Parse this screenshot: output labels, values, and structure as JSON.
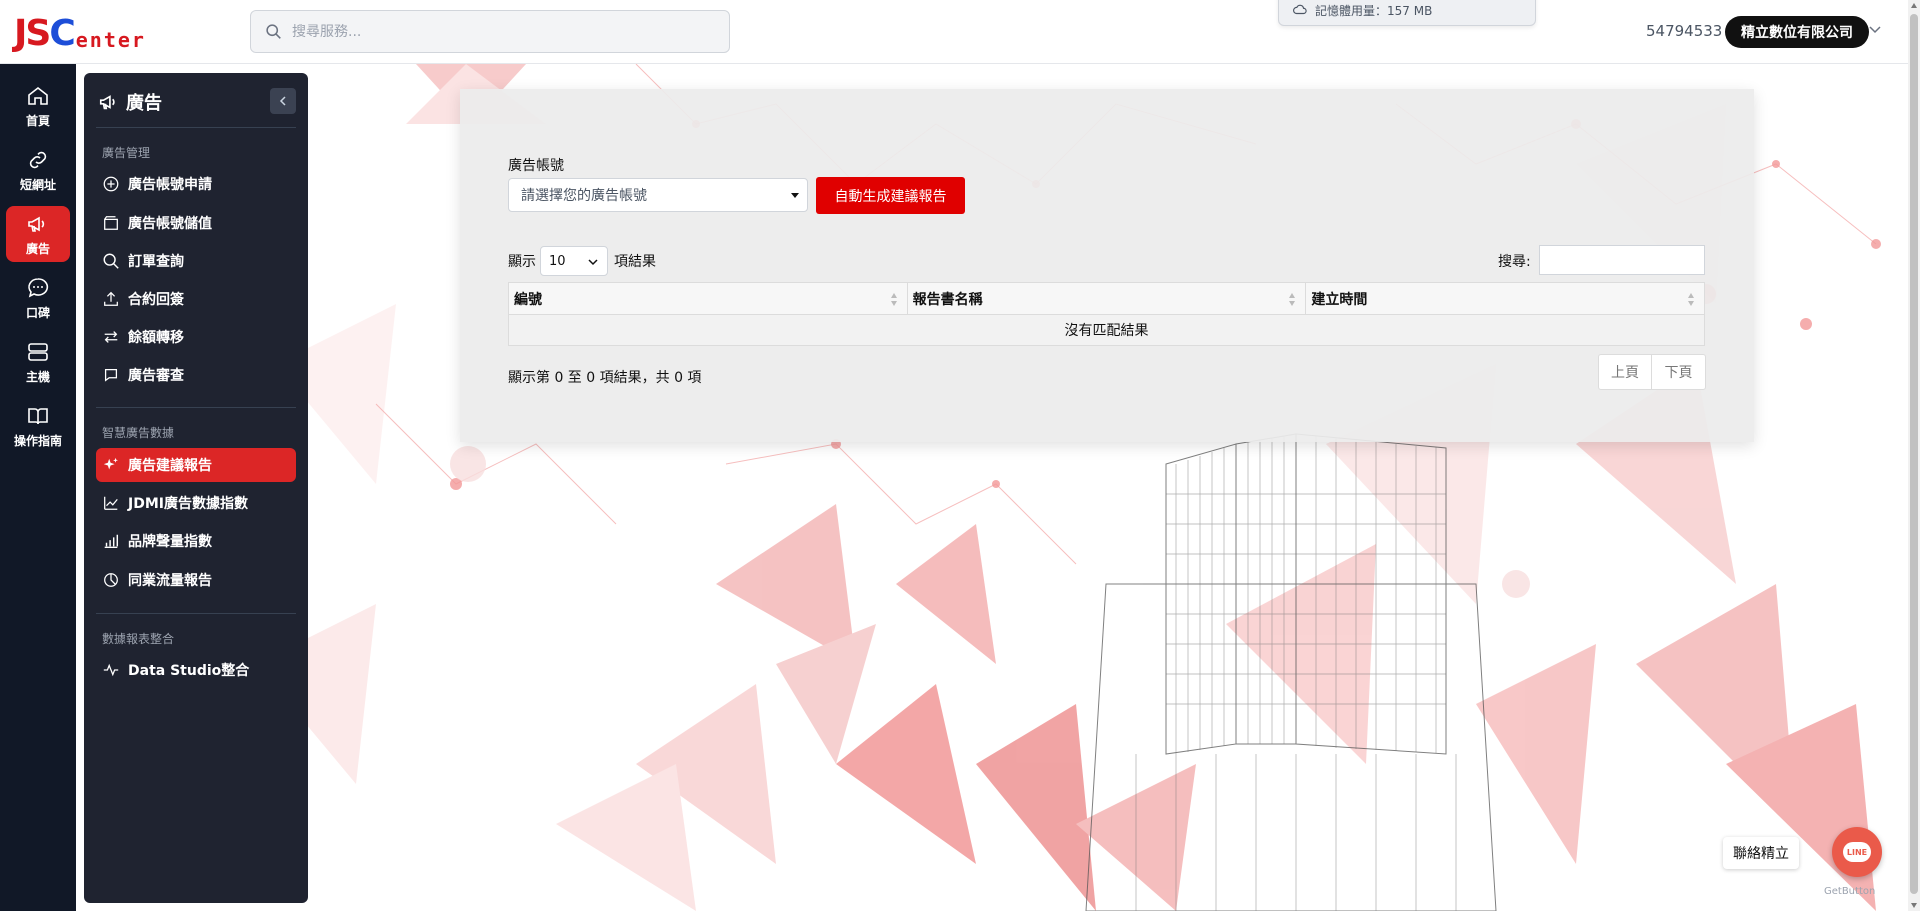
{
  "header": {
    "logo_text_main": "JSC",
    "logo_text_sub": "enter",
    "search_placeholder": "搜尋服務...",
    "memory_usage": "記憶體用量：157 MB",
    "user_id": "54794533",
    "company_name": "精立數位有限公司"
  },
  "rail": {
    "items": [
      {
        "label": "首頁",
        "icon": "home-icon"
      },
      {
        "label": "短網址",
        "icon": "link-icon"
      },
      {
        "label": "廣告",
        "icon": "megaphone-icon",
        "active": true
      },
      {
        "label": "口碑",
        "icon": "chat-icon"
      },
      {
        "label": "主機",
        "icon": "server-icon"
      },
      {
        "label": "操作指南",
        "icon": "book-icon"
      }
    ]
  },
  "sidebar": {
    "title": "廣告",
    "sections": [
      {
        "title": "廣告管理",
        "items": [
          {
            "label": "廣告帳號申請",
            "icon": "plus-circle-icon"
          },
          {
            "label": "廣告帳號儲值",
            "icon": "wallet-icon"
          },
          {
            "label": "訂單查詢",
            "icon": "search-icon"
          },
          {
            "label": "合約回簽",
            "icon": "upload-icon"
          },
          {
            "label": "餘額轉移",
            "icon": "transfer-icon"
          },
          {
            "label": "廣告審查",
            "icon": "message-icon"
          }
        ]
      },
      {
        "title": "智慧廣告數據",
        "items": [
          {
            "label": "廣告建議報告",
            "icon": "sparkle-icon",
            "active": true
          },
          {
            "label": "JDMI廣告數據指數",
            "icon": "trend-icon"
          },
          {
            "label": "品牌聲量指數",
            "icon": "bars-icon"
          },
          {
            "label": "同業流量報告",
            "icon": "pie-icon"
          }
        ]
      },
      {
        "title": "數據報表整合",
        "items": [
          {
            "label": "Data Studio整合",
            "icon": "pulse-icon"
          }
        ]
      }
    ]
  },
  "main": {
    "account_label": "廣告帳號",
    "account_placeholder": "請選擇您的廣告帳號",
    "generate_button": "自動生成建議報告",
    "show_prefix": "顯示",
    "page_length": "10",
    "show_suffix": "項結果",
    "search_label": "搜尋:",
    "columns": [
      "編號",
      "報告書名稱",
      "建立時間"
    ],
    "empty_message": "沒有匹配結果",
    "info": "顯示第 0 至 0 項結果，共 0 項",
    "prev": "上頁",
    "next": "下頁"
  },
  "contact": {
    "label": "聯絡精立",
    "line_text": "LINE",
    "getbutton": "GetButton"
  },
  "colors": {
    "accent": "#dc2626",
    "button_red": "#e00000",
    "rail_bg": "#111827",
    "panel_bg": "#1f2330"
  }
}
